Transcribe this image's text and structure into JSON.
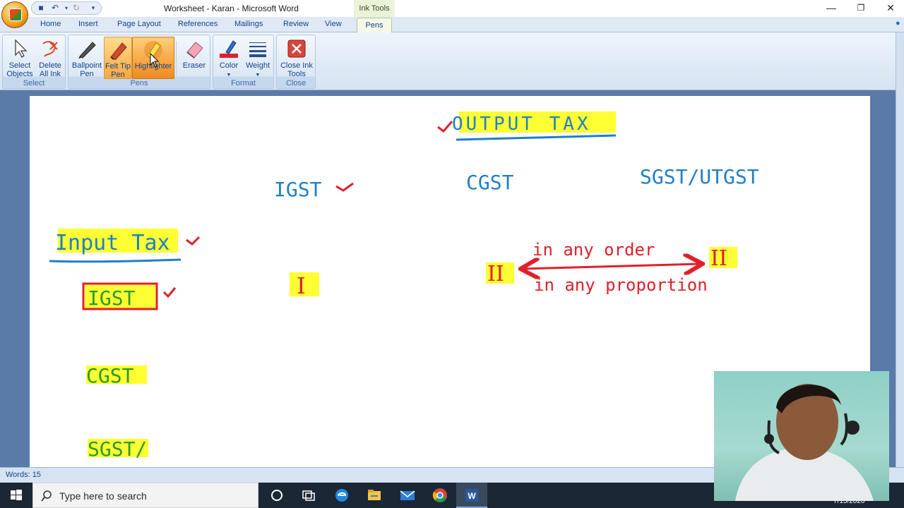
{
  "window": {
    "title": "Worksheet - Karan - Microsoft Word",
    "contextual_tab": "Ink Tools",
    "controls": [
      "minimize",
      "restore",
      "close"
    ]
  },
  "tabs": [
    "Home",
    "Insert",
    "Page Layout",
    "References",
    "Mailings",
    "Review",
    "View"
  ],
  "active_tab": "Pens",
  "ribbon": {
    "groups": {
      "select": "Select",
      "pens": "Pens",
      "format": "Format",
      "close": "Close"
    },
    "buttons": {
      "select_objects": [
        "Select",
        "Objects"
      ],
      "delete_ink": [
        "Delete",
        "All Ink"
      ],
      "ballpoint": [
        "Ballpoint",
        "Pen"
      ],
      "felt_tip": [
        "Felt Tip",
        "Pen"
      ],
      "highlighter": "Highlighter",
      "eraser": "Eraser",
      "color": "Color",
      "weight": "Weight",
      "close_ink": [
        "Close Ink",
        "Tools"
      ]
    }
  },
  "document": {
    "output_tax": "OUTPUT TAX",
    "igst_top": "IGST",
    "cgst_top": "CGST",
    "sgst_utgst": "SGST/UTGST",
    "input_tax": "Input Tax",
    "igst_box": "IGST",
    "cgst_left": "CGST",
    "sgst_left": "SGST/",
    "roman_one": "I",
    "roman_two_left": "II",
    "roman_two_right": "II",
    "any_order": "in any order",
    "any_proportion": "in any proportion"
  },
  "status": {
    "words": "Words: 15"
  },
  "taskbar": {
    "search_placeholder": "Type here to search",
    "clock_date": "7/15/2020"
  },
  "colors": {
    "ink_blue": "#1e7fc8",
    "ink_red": "#e0202a",
    "ink_green": "#2a9a2a",
    "highlight": "#ffff33",
    "ribbon_blue": "#15428b"
  }
}
